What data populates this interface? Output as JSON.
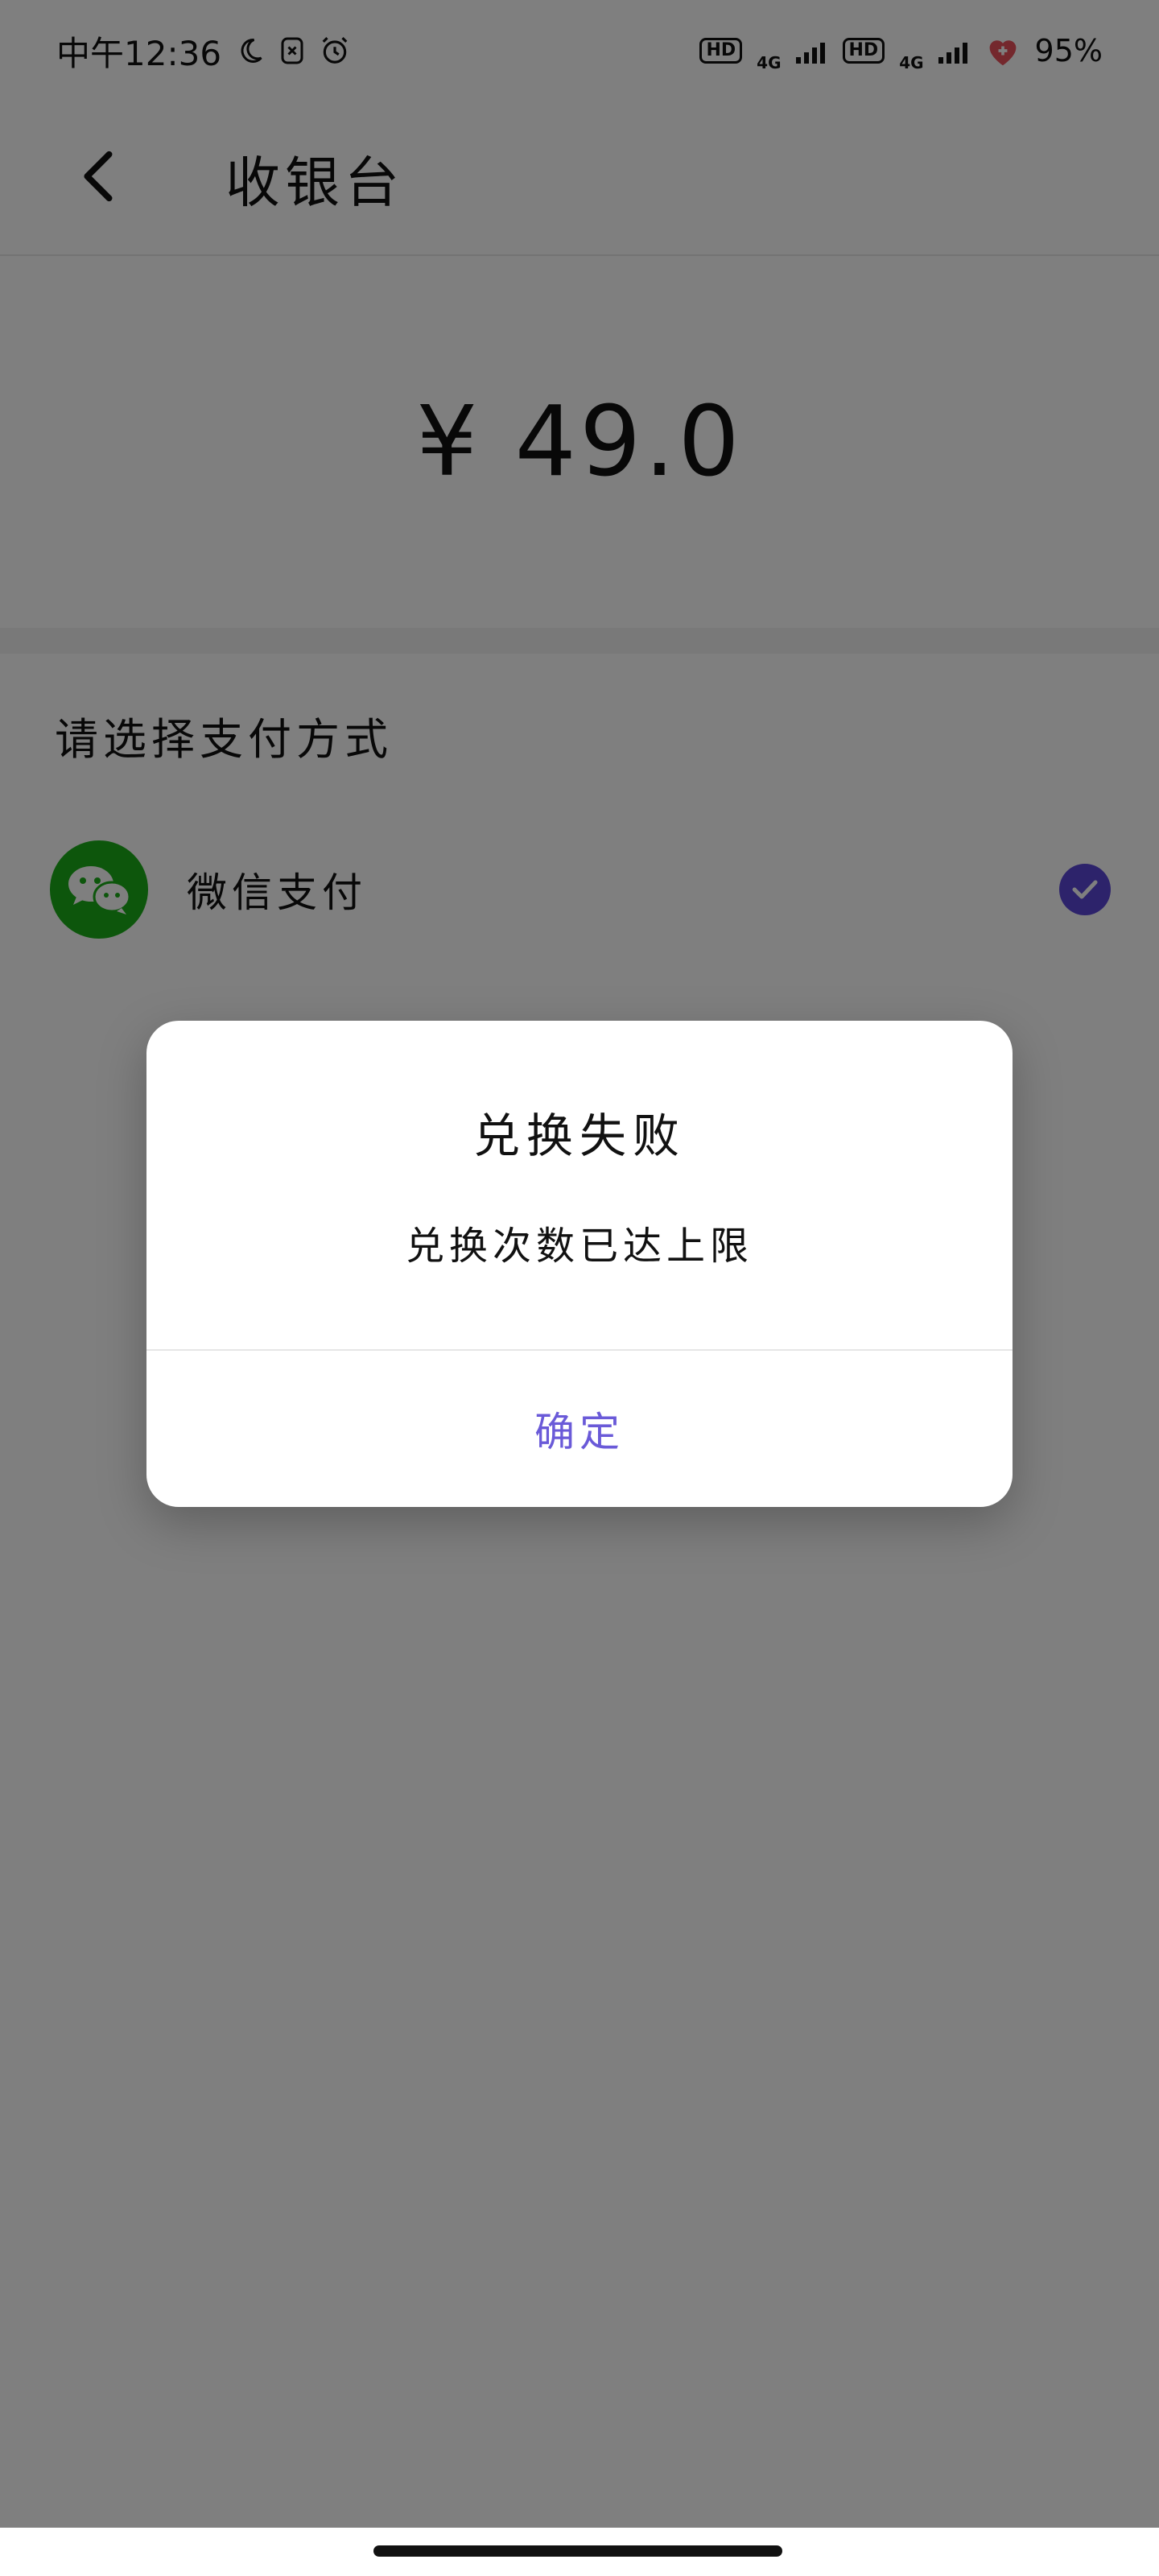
{
  "status_bar": {
    "time": "中午12:36",
    "icons_left": [
      "moon-icon",
      "notification-icon",
      "alarm-icon"
    ],
    "sim1_label": "HD",
    "sim1_network": "4G",
    "sim2_label": "HD",
    "sim2_network": "4G",
    "battery": "95%"
  },
  "nav": {
    "title": "收银台",
    "back_icon": "chevron-left-icon"
  },
  "payment": {
    "amount": "¥ 49.0",
    "heading": "请选择支付方式",
    "methods": [
      {
        "label": "微信支付",
        "icon": "wechat-icon",
        "selected": true
      }
    ]
  },
  "dialog": {
    "title": "兑换失败",
    "message": "兑换次数已达上限",
    "confirm_label": "确定"
  },
  "colors": {
    "accent": "#5a46d6",
    "dialog_button": "#6a5ad8",
    "wechat_green": "#1aad19"
  }
}
